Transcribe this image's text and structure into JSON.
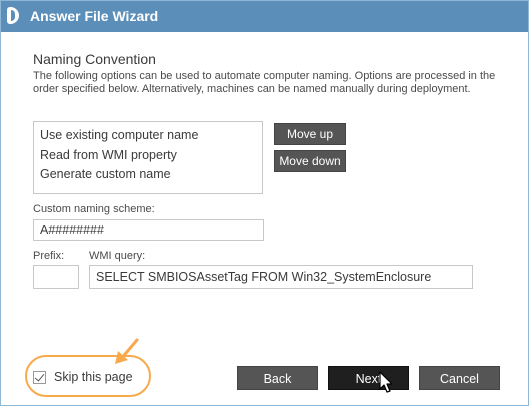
{
  "window": {
    "title": "Answer File Wizard"
  },
  "section": {
    "heading": "Naming Convention",
    "description": "The following options can be used to automate computer naming. Options are processed in the order specified below. Alternatively, machines can be named manually during deployment."
  },
  "options_list": [
    "Use existing computer name",
    "Read from WMI property",
    "Generate custom name"
  ],
  "buttons": {
    "move_up": "Move up",
    "move_down": "Move down",
    "back": "Back",
    "next": "Next",
    "cancel": "Cancel"
  },
  "fields": {
    "custom_scheme_label": "Custom naming scheme:",
    "custom_scheme_value": "A########",
    "prefix_label": "Prefix:",
    "prefix_value": "",
    "wmi_query_label": "WMI query:",
    "wmi_query_value": "SELECT SMBIOSAssetTag FROM Win32_SystemEnclosure"
  },
  "skip_page": {
    "label": "Skip this page",
    "checked": true
  },
  "colors": {
    "titlebar": "#5b8fb9",
    "button": "#555555",
    "primary_button": "#1f1f1f",
    "highlight": "#f7a94b"
  }
}
